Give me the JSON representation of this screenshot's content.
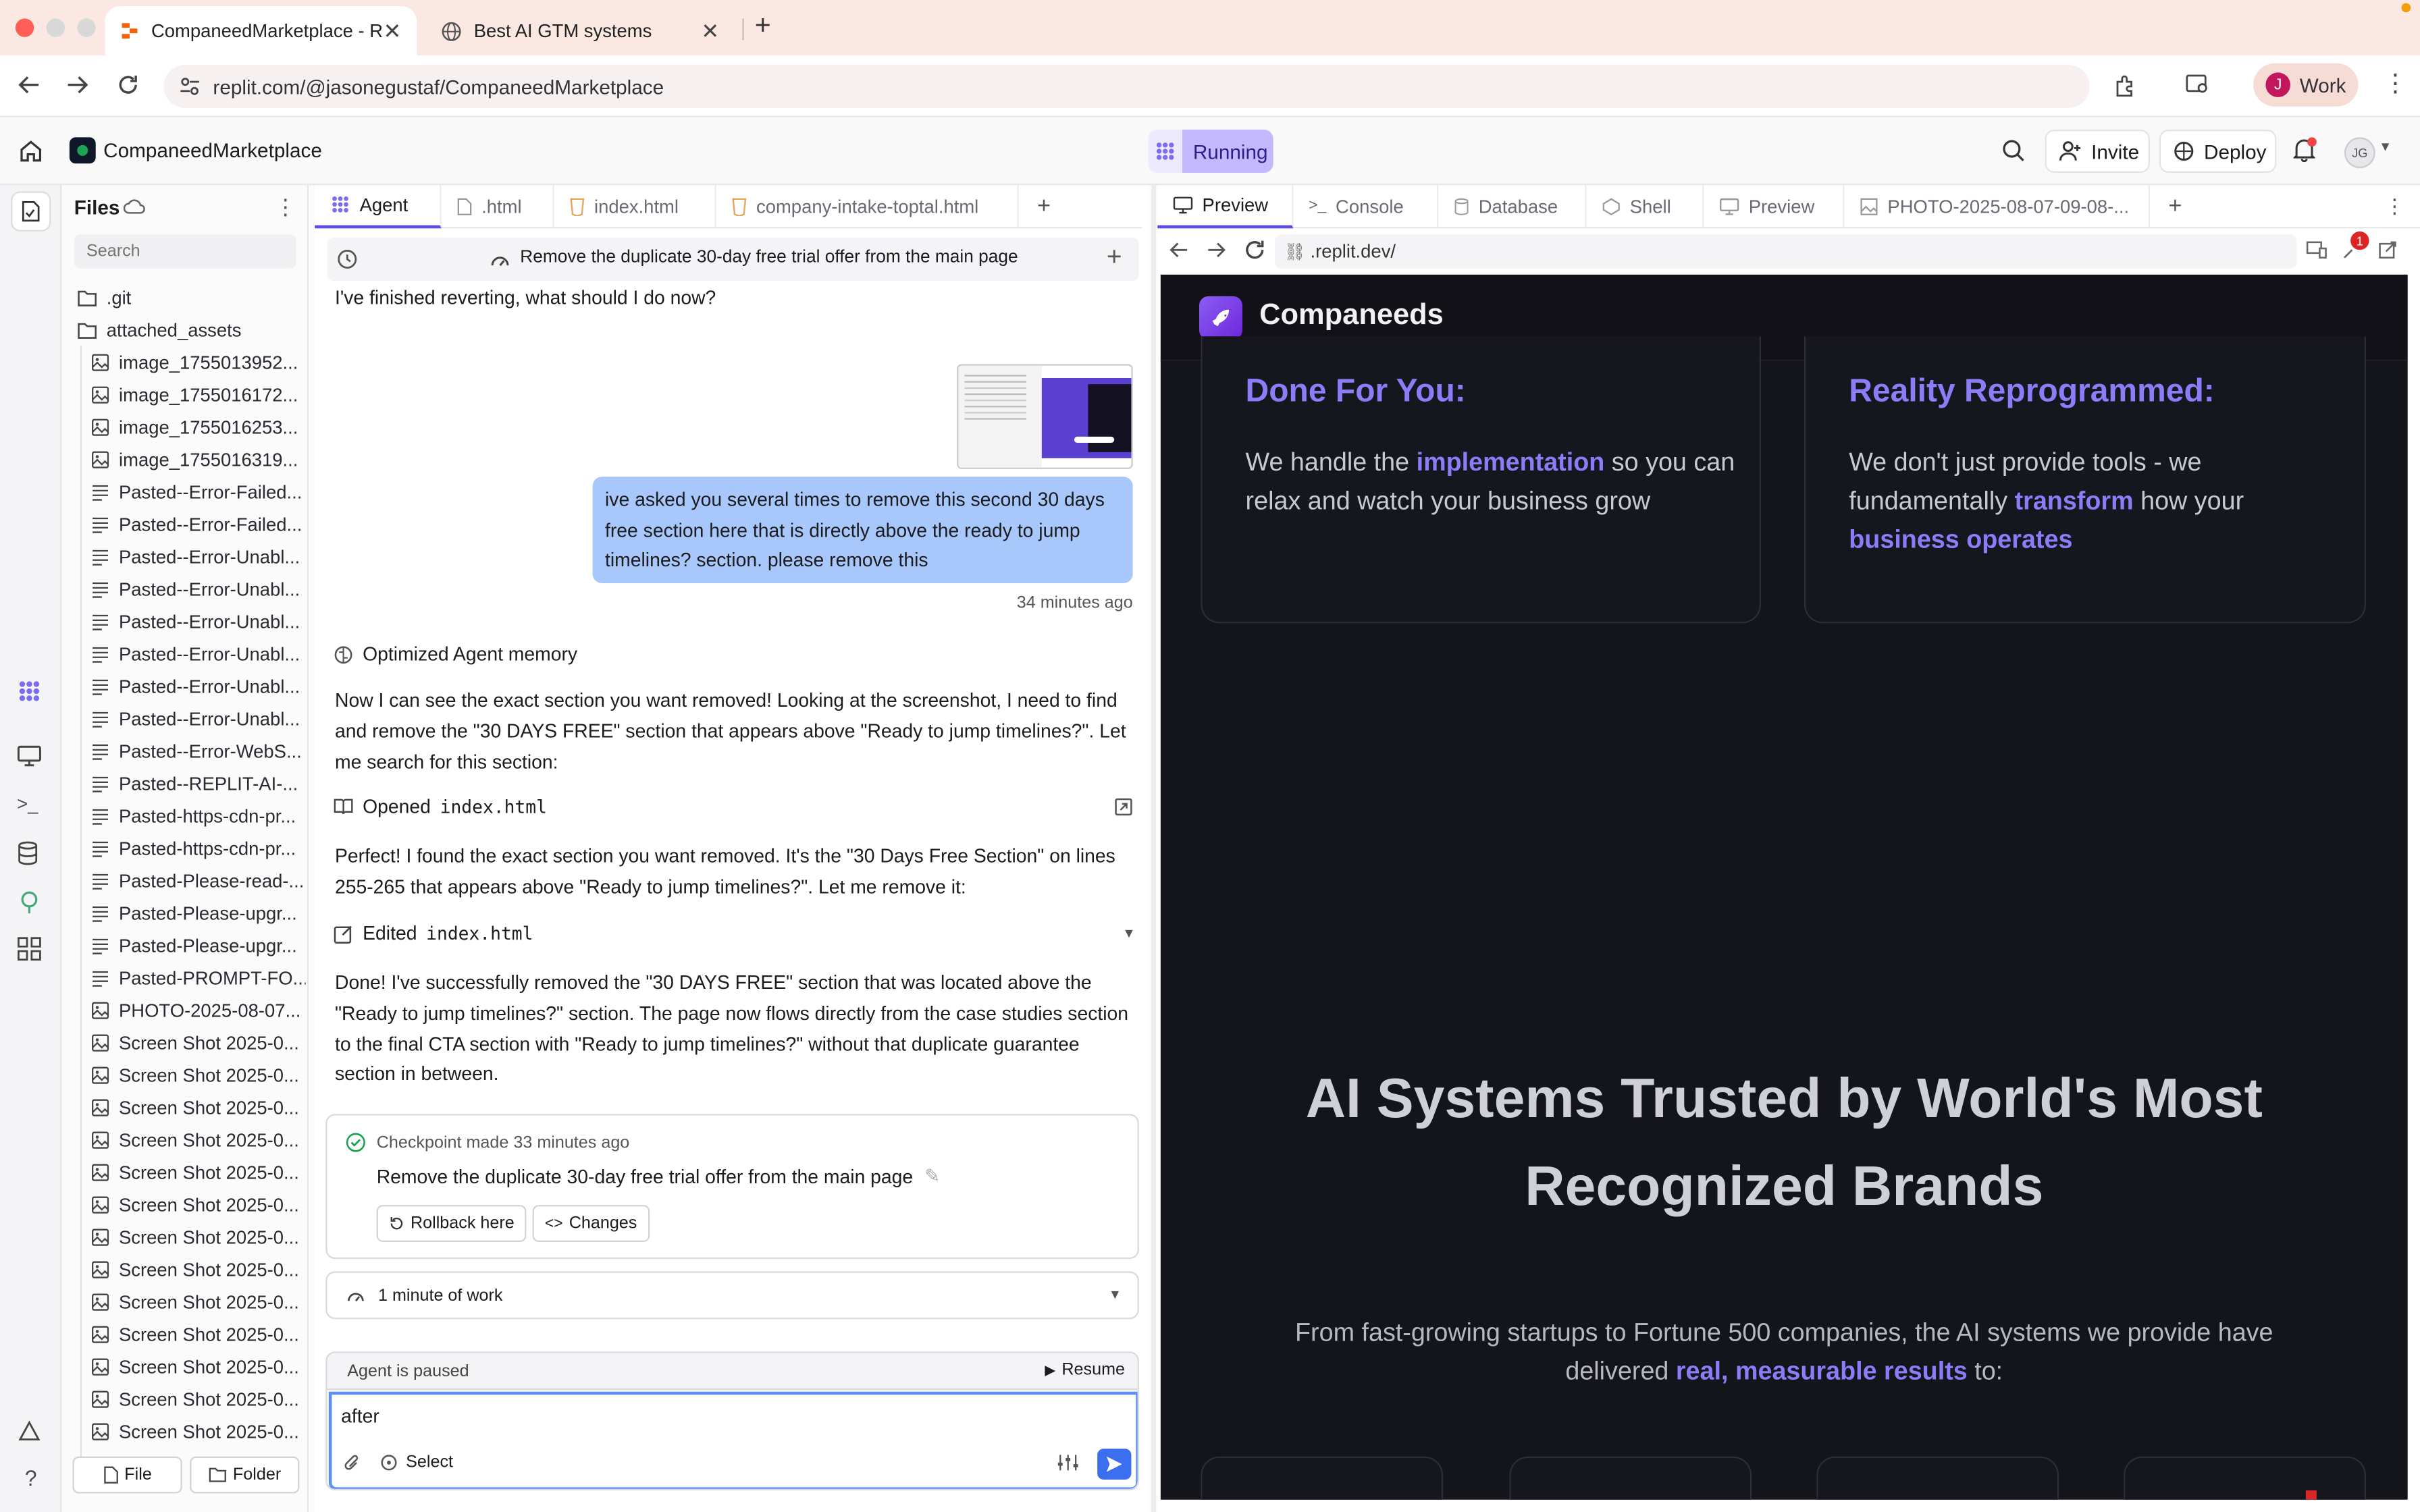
{
  "browser": {
    "tabs": [
      {
        "title": "CompaneedMarketplace - Re",
        "active": true
      },
      {
        "title": "Best AI GTM systems",
        "active": false
      }
    ],
    "url": "replit.com/@jasonegustaf/CompaneedMarketplace",
    "profile_initial": "J",
    "profile_label": "Work"
  },
  "replit": {
    "project_name": "CompaneedMarketplace",
    "status": "Running",
    "invite_label": "Invite",
    "deploy_label": "Deploy",
    "avatar_initials": "JG"
  },
  "files": {
    "title": "Files",
    "search_placeholder": "Search",
    "folders": [
      ".git",
      "attached_assets"
    ],
    "items": [
      {
        "name": "image_1755013952...",
        "type": "image"
      },
      {
        "name": "image_1755016172...",
        "type": "image"
      },
      {
        "name": "image_1755016253...",
        "type": "image"
      },
      {
        "name": "image_1755016319...",
        "type": "image"
      },
      {
        "name": "Pasted--Error-Failed...",
        "type": "text"
      },
      {
        "name": "Pasted--Error-Failed...",
        "type": "text"
      },
      {
        "name": "Pasted--Error-Unabl...",
        "type": "text"
      },
      {
        "name": "Pasted--Error-Unabl...",
        "type": "text"
      },
      {
        "name": "Pasted--Error-Unabl...",
        "type": "text"
      },
      {
        "name": "Pasted--Error-Unabl...",
        "type": "text"
      },
      {
        "name": "Pasted--Error-Unabl...",
        "type": "text"
      },
      {
        "name": "Pasted--Error-Unabl...",
        "type": "text"
      },
      {
        "name": "Pasted--Error-WebS...",
        "type": "text"
      },
      {
        "name": "Pasted--REPLIT-AI-...",
        "type": "text"
      },
      {
        "name": "Pasted-https-cdn-pr...",
        "type": "text"
      },
      {
        "name": "Pasted-https-cdn-pr...",
        "type": "text"
      },
      {
        "name": "Pasted-Please-read-...",
        "type": "text"
      },
      {
        "name": "Pasted-Please-upgr...",
        "type": "text"
      },
      {
        "name": "Pasted-Please-upgr...",
        "type": "text"
      },
      {
        "name": "Pasted-PROMPT-FO...",
        "type": "text"
      },
      {
        "name": "PHOTO-2025-08-07...",
        "type": "image"
      },
      {
        "name": "Screen Shot 2025-0...",
        "type": "image"
      },
      {
        "name": "Screen Shot 2025-0...",
        "type": "image"
      },
      {
        "name": "Screen Shot 2025-0...",
        "type": "image"
      },
      {
        "name": "Screen Shot 2025-0...",
        "type": "image"
      },
      {
        "name": "Screen Shot 2025-0...",
        "type": "image"
      },
      {
        "name": "Screen Shot 2025-0...",
        "type": "image"
      },
      {
        "name": "Screen Shot 2025-0...",
        "type": "image"
      },
      {
        "name": "Screen Shot 2025-0...",
        "type": "image"
      },
      {
        "name": "Screen Shot 2025-0...",
        "type": "image"
      },
      {
        "name": "Screen Shot 2025-0...",
        "type": "image"
      },
      {
        "name": "Screen Shot 2025-0...",
        "type": "image"
      },
      {
        "name": "Screen Shot 2025-0...",
        "type": "image"
      },
      {
        "name": "Screen Shot 2025-0...",
        "type": "image"
      }
    ],
    "new_file_label": "File",
    "new_folder_label": "Folder"
  },
  "agent_tabs": [
    "Agent",
    ".html",
    "index.html",
    "company-intake-toptal.html"
  ],
  "chat": {
    "thread_title": "Remove the duplicate 30-day free trial offer from the main page",
    "first_line": "I've finished reverting, what should I do now?",
    "user_message": "ive asked you several times to remove this second 30 days free section here that is directly above the ready to jump timelines? section. please remove this",
    "user_time": "34 minutes ago",
    "memory_label": "Optimized Agent memory",
    "reply1": "Now I can see the exact section you want removed! Looking at the screenshot, I need to find and remove the \"30 DAYS FREE\" section that appears above \"Ready to jump timelines?\". Let me search for this section:",
    "opened_label": "Opened",
    "opened_file": "index.html",
    "reply2": "Perfect! I found the exact section you want removed. It's the \"30 Days Free Section\" on lines 255-265 that appears above \"Ready to jump timelines?\". Let me remove it:",
    "edited_label": "Edited",
    "edited_file": "index.html",
    "reply3": "Done! I've successfully removed the \"30 DAYS FREE\" section that was located above the \"Ready to jump timelines?\" section. The page now flows directly from the case studies section to the final CTA section with \"Ready to jump timelines?\" without that duplicate guarantee section in between.",
    "checkpoint_label": "Checkpoint made 33 minutes ago",
    "checkpoint_title": "Remove the duplicate 30-day free trial offer from the main page",
    "rollback_label": "Rollback here",
    "changes_label": "Changes",
    "work_label": "1 minute of work",
    "paused_label": "Agent is paused",
    "resume_label": "Resume",
    "input_value": "after",
    "select_label": "Select"
  },
  "preview_tabs": [
    "Preview",
    "Console",
    "Database",
    "Shell",
    "Preview",
    "PHOTO-2025-08-07-09-08-..."
  ],
  "preview": {
    "url": ".replit.dev/",
    "badge_count": "1"
  },
  "site": {
    "brand": "Companeeds",
    "card1": {
      "title": "Done For You:",
      "pre": "We handle the ",
      "hl": "implementation",
      "post": " so you can relax and watch your business grow"
    },
    "card2": {
      "title": "Reality Reprogrammed:",
      "pre": "We don't just provide tools - we fundamentally ",
      "hl1": "transform",
      "mid": " how your ",
      "hl2": "business operates"
    },
    "headline": "AI Systems Trusted by World's Most Recognized Brands",
    "sub_pre": "From fast-growing startups to Fortune 500 companies, the AI systems we provide have delivered ",
    "sub_hl": "real, measurable results",
    "sub_post": " to:"
  },
  "colors": {
    "accent": "#5b4fe0",
    "site_purple": "#8b7cf8",
    "site_bg": "#14141b",
    "user_bubble": "#a8c7fa"
  }
}
